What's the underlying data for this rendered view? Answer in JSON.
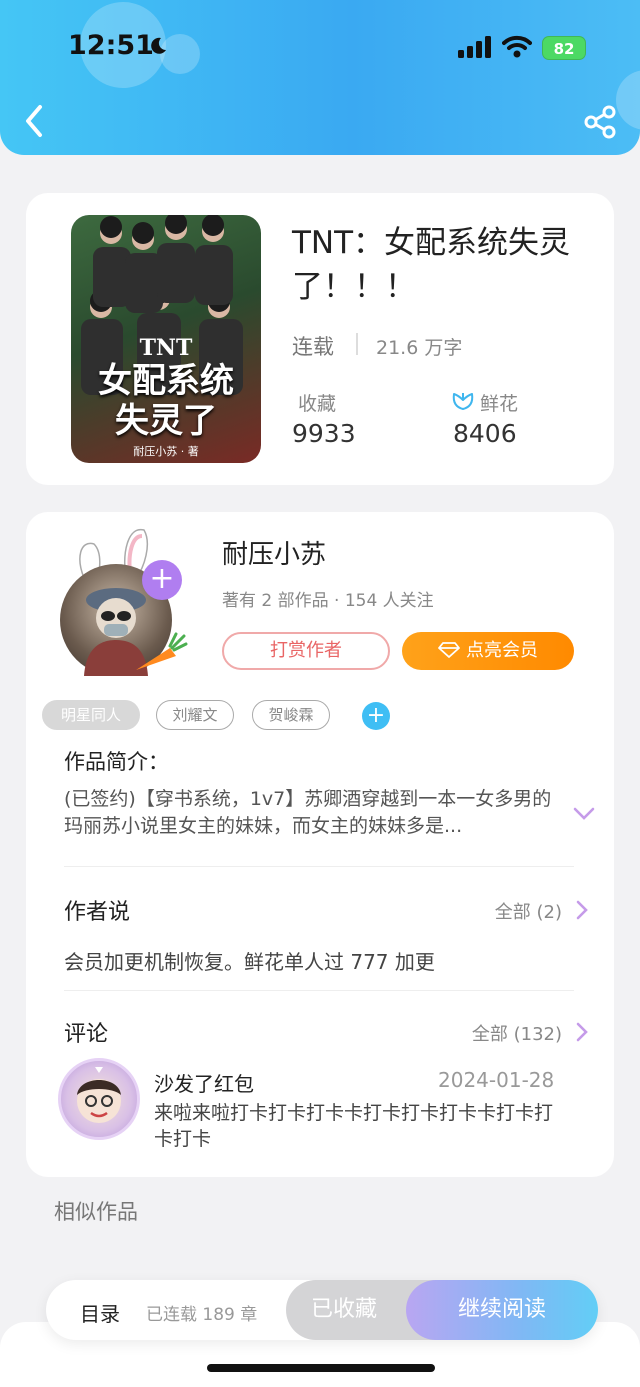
{
  "status_bar": {
    "time": "12:51",
    "battery": "82"
  },
  "book": {
    "cover": {
      "tnt": "TNT",
      "title": "女配系统\n失灵了",
      "author": "耐压小苏 · 著"
    },
    "title": "TNT：女配系统失灵了！！！",
    "status": "连载",
    "words": "21.6 万字",
    "fav_label": "收藏",
    "fav_count": "9933",
    "flower_label": "鲜花",
    "flower_count": "8406"
  },
  "author": {
    "name": "耐压小苏",
    "meta": "著有 2 部作品 · 154 人关注",
    "tip_label": "打赏作者",
    "vip_label": "点亮会员"
  },
  "tags": [
    "明星同人",
    "刘耀文",
    "贺峻霖"
  ],
  "intro": {
    "title": "作品简介：",
    "text": "(已签约)【穿书系统，1v7】苏卿酒穿越到一本一女多男的玛丽苏小说里女主的妹妹，而女主的妹妹多是..."
  },
  "author_say": {
    "title": "作者说",
    "link": "全部 (2)",
    "text": "会员加更机制恢复。鲜花单人过 777 加更"
  },
  "comments": {
    "title": "评论",
    "link": "全部 (132)",
    "item": {
      "user": "沙发了红包",
      "date": "2024-01-28",
      "text": "来啦来啦打卡打卡打卡卡打卡打卡打卡卡打卡打卡打卡"
    }
  },
  "similar_label": "相似作品",
  "bottom": {
    "toc_label": "目录",
    "chapters": "已连载 189 章",
    "saved_label": "已收藏",
    "read_label": "继续阅读"
  },
  "colors": {
    "accent": "#3aa9f2",
    "vip": "#ff8a00",
    "purple": "#b07ef0"
  }
}
